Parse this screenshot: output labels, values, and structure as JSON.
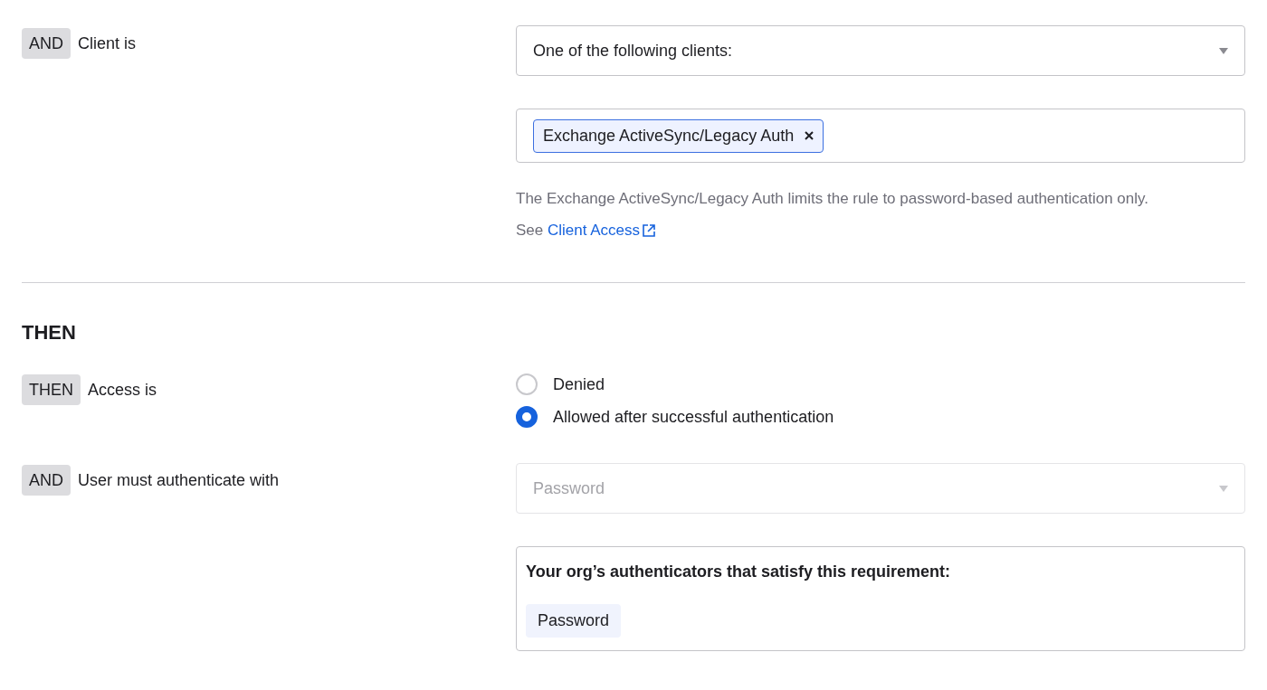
{
  "client_condition": {
    "badge": "AND",
    "label": "Client is",
    "select": {
      "value": "One of the following clients:",
      "disabled": false
    },
    "tags": [
      {
        "label": "Exchange ActiveSync/Legacy Auth"
      }
    ],
    "help": {
      "text": "The Exchange ActiveSync/Legacy Auth limits the rule to password-based authentication only. See",
      "link": "Client Access"
    }
  },
  "then_section": {
    "heading": "THEN",
    "access": {
      "badge": "THEN",
      "label": "Access is",
      "options": [
        {
          "label": "Denied",
          "selected": false
        },
        {
          "label": "Allowed after successful authentication",
          "selected": true
        }
      ]
    },
    "authenticate": {
      "badge": "AND",
      "label": "User must authenticate with",
      "select": {
        "value": "Password",
        "disabled": true
      },
      "authenticators": {
        "title": "Your org’s authenticators that satisfy this requirement:",
        "items": [
          "Password"
        ]
      }
    }
  }
}
